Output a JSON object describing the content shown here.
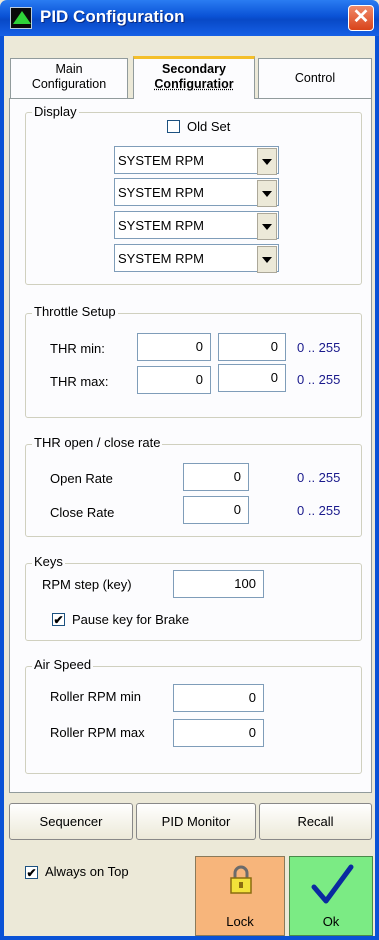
{
  "window": {
    "title": "PID Configuration",
    "close_glyph": "✕"
  },
  "tabs": [
    {
      "line1": "Main",
      "line2": "Configuration"
    },
    {
      "line1": "Secondary",
      "line2": "Configuratior"
    },
    {
      "line1": "Control",
      "line2": ""
    }
  ],
  "display": {
    "legend": "Display",
    "old_set_label": "Old Set",
    "old_set_checked": false,
    "combos": [
      "SYSTEM RPM",
      "SYSTEM RPM",
      "SYSTEM RPM",
      "SYSTEM RPM"
    ]
  },
  "throttle": {
    "legend": "Throttle Setup",
    "min_label": "THR min:",
    "max_label": "THR max:",
    "min_values": [
      "0",
      "0"
    ],
    "max_values": [
      "0",
      "0"
    ],
    "range": "0 .. 255"
  },
  "rate": {
    "legend": "THR open / close rate",
    "open_label": "Open Rate",
    "close_label": "Close Rate",
    "open_value": "0",
    "close_value": "0",
    "range": "0 .. 255"
  },
  "keys": {
    "legend": "Keys",
    "rpm_step_label": "RPM step (key)",
    "rpm_step_value": "100",
    "pause_brake_label": "Pause key for Brake",
    "pause_brake_checked": true,
    "check_glyph": "✔"
  },
  "air_speed": {
    "legend": "Air Speed",
    "min_label": "Roller RPM min",
    "max_label": "Roller RPM max",
    "min_value": "0",
    "max_value": "0"
  },
  "bottom_buttons": {
    "sequencer": "Sequencer",
    "pid_monitor": "PID Monitor",
    "recall": "Recall"
  },
  "always_on_top": {
    "label": "Always on Top",
    "checked": true,
    "glyph": "✔"
  },
  "lock": {
    "label": "Lock",
    "color": "#F7B57B"
  },
  "ok": {
    "label": "Ok",
    "color": "#7BEB84"
  }
}
